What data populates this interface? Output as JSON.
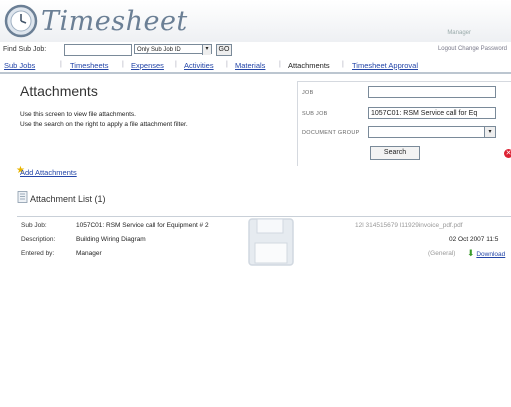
{
  "app": {
    "title": "Timesheet",
    "user": "Manager"
  },
  "search": {
    "label": "Find Sub Job:",
    "value": "",
    "filter_selected": "Only Sub Job ID",
    "go_label": "GO"
  },
  "top_links": "Logout Change Password",
  "nav": {
    "tabs": [
      {
        "label": "Sub Jobs"
      },
      {
        "label": "Timesheets"
      },
      {
        "label": "Expenses"
      },
      {
        "label": "Activities"
      },
      {
        "label": "Materials"
      },
      {
        "label": "Attachments"
      },
      {
        "label": "Timesheet Approval"
      }
    ],
    "active": "Attachments"
  },
  "page": {
    "title": "Attachments",
    "desc1": "Use this screen to view file attachments.",
    "desc2": "Use the search on the right to apply a file attachment filter."
  },
  "filter": {
    "job_label": "JOB",
    "job_value": "",
    "subjob_label": "SUB JOB",
    "subjob_value": "1057C01: RSM Service call for Eq",
    "docgroup_label": "DOCUMENT GROUP",
    "docgroup_value": "",
    "search_label": "Search"
  },
  "actions": {
    "add_attachments": "Add Attachments"
  },
  "list": {
    "title": "Attachment List (1)",
    "records": [
      {
        "subjob_label": "Sub Job:",
        "subjob": "1057C01: RSM Service call for Equipment # 2",
        "desc_label": "Description:",
        "description": "Building Wiring Diagram",
        "entered_label": "Entered by:",
        "entered_by": "Manager",
        "filename": "12l 314515679 l11929invoice_pdf.pdf",
        "date": "02 Oct 2007 11:5",
        "group": "(General)",
        "download": "Download"
      }
    ]
  }
}
